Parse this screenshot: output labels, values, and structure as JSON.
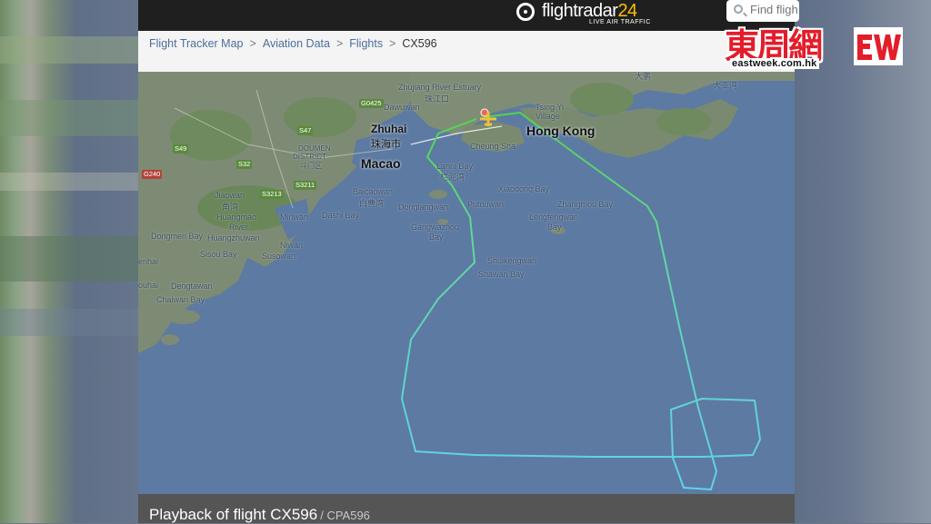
{
  "header": {
    "logo_main": "flightradar",
    "logo_num": "24",
    "logo_sub": "LIVE AIR TRAFFIC",
    "search_placeholder": "Find fligh"
  },
  "breadcrumb": [
    "Flight Tracker Map",
    "Aviation Data",
    "Flights",
    "CX596"
  ],
  "map": {
    "cities": {
      "zhuhai": "Zhuhai",
      "zhuhai_zh": "珠海市",
      "macao": "Macao",
      "hongkong": "Hong Kong"
    },
    "labels": {
      "zhujiang": "Zhujiang River Estuary",
      "zhujiang_zh": "珠江口",
      "dawuwan": "Dawuwan",
      "tsingyi": "Tsing Yi",
      "village": "Village",
      "cheungsha": "Cheung Sha",
      "lannibay": "Lanni Bay",
      "lannibay_zh": "栏泥湾",
      "baicaowan": "Baicaowan",
      "baicaowan_zh": "白曹湾",
      "donglangwan": "Donglangwan",
      "putouwan": "Putouwan",
      "gangwazhou": "Gangwazhou",
      "bay": "Bay",
      "xiaodong": "Xiaodong Bay",
      "zhangmou": "Zhangmou Bay",
      "lengfeng": "Lengfengwan",
      "lengfeng2": "Bay",
      "shuikeng": "Shuikengwan",
      "shawan": "Shawan Bay",
      "doumen": "DOUMEN",
      "district": "DISTRICT",
      "doumen_zh": "斗门区",
      "jiaowan": "Jiaowan",
      "jiaowan_zh": "角湾",
      "huangmao": "Huangmao",
      "huangmao2": "River",
      "minwan": "Minwan",
      "dashibay": "Dashi Bay",
      "dongmen": "Dongmen Bay",
      "huangzhuwan": "Huangzhuwan",
      "sisou": "Sisou Bay",
      "niwan": "Niwan",
      "susowan": "Susowan",
      "enhai": "enhai",
      "ouhai": "ouhai",
      "dengtawan": "Dengtawan",
      "chaiwan": "Chaiwan Bay",
      "dapeng": "大鹏",
      "dawan": "大湾",
      "dayabay": "大亚湾",
      "daya2": "大亚湾"
    },
    "shields": [
      "G0425",
      "S47",
      "S49",
      "S32",
      "G240",
      "S3213",
      "S3211"
    ]
  },
  "playback": {
    "title": "Playback of flight CX596",
    "sub": "/ CPA596"
  },
  "watermark": {
    "chars": "東周網",
    "url": "eastweek.com.hk"
  },
  "colors": {
    "sea": "#5d7aa2",
    "land": "#7d8b74",
    "track_green": "#52d64a",
    "track_cyan": "#5fd2ef",
    "brand_red": "#e41d2a"
  }
}
